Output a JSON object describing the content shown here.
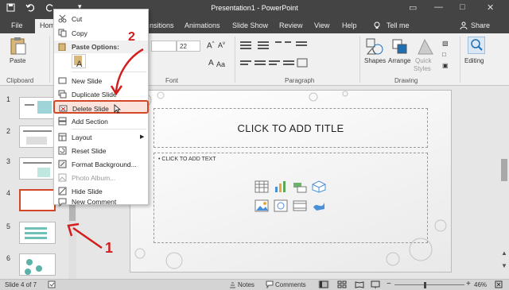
{
  "title_bar": {
    "title": "Presentation1  -  PowerPoint",
    "qat_more": "▾",
    "restore_icon": "▭",
    "minimize": "—",
    "maximize": "□",
    "close": "✕"
  },
  "tabs": {
    "file": "File",
    "home": "Hom",
    "transitions": "nsitions",
    "animations": "Animations",
    "slide_show": "Slide Show",
    "review": "Review",
    "view": "View",
    "help": "Help",
    "tell_me": "Tell me",
    "share": "Share"
  },
  "ribbon": {
    "paste": "Paste",
    "clipboard": "Clipboard",
    "font_size": "22",
    "font_group": "Font",
    "paragraph_group": "Paragraph",
    "shapes": "Shapes",
    "arrange": "Arrange",
    "quick_styles": "Quick",
    "quick_styles2": "Styles",
    "drawing_group": "Drawing",
    "editing": "Editing"
  },
  "thumbnails": {
    "numbers": [
      "1",
      "2",
      "3",
      "4",
      "5",
      "6"
    ]
  },
  "slide": {
    "title_placeholder": "CLICK TO ADD TITLE",
    "text_placeholder": "CLICK TO ADD TEXT"
  },
  "context_menu": {
    "cut": "Cut",
    "copy": "Copy",
    "paste_options": "Paste Options:",
    "new_slide": "New Slide",
    "duplicate_slide": "Duplicate Slide",
    "delete_slide": "Delete Slide",
    "add_section": "Add Section",
    "layout": "Layout",
    "reset_slide": "Reset Slide",
    "format_background": "Format Background...",
    "photo_album": "Photo Album...",
    "hide_slide": "Hide Slide",
    "new_comment": "New Comment"
  },
  "annotations": {
    "label_1": "1",
    "label_2": "2"
  },
  "status_bar": {
    "slide_info": "Slide 4 of 7",
    "notes": "Notes",
    "comments": "Comments",
    "zoom_minus": "−",
    "zoom_plus": "+",
    "zoom": "46%"
  },
  "colors": {
    "accent": "#d24726",
    "annotation": "#d21e1e",
    "titlebar": "#444444"
  }
}
